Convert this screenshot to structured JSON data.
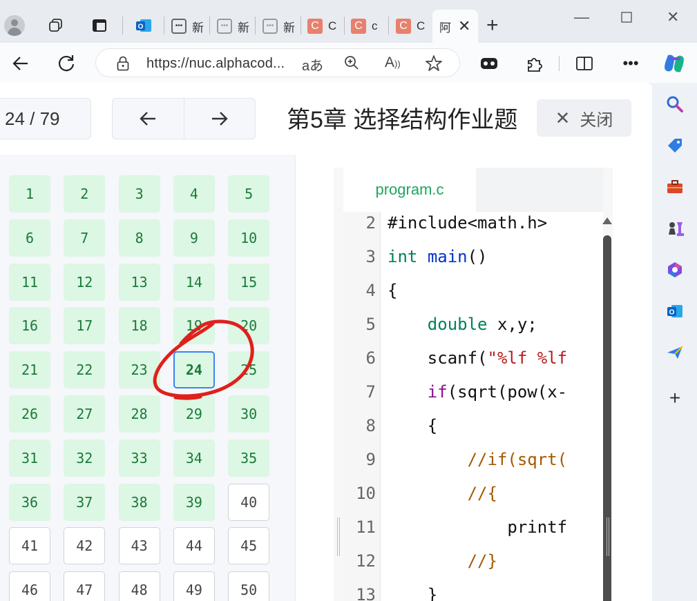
{
  "browser": {
    "tabs": [
      {
        "label": "",
        "kind": "workspaces"
      },
      {
        "label": "",
        "kind": "vertical-tabs"
      },
      {
        "label": "",
        "kind": "outlook"
      },
      {
        "label": "新",
        "kind": "page"
      },
      {
        "label": "新",
        "kind": "page"
      },
      {
        "label": "新",
        "kind": "page"
      },
      {
        "label": "C",
        "kind": "c"
      },
      {
        "label": "c",
        "kind": "c"
      },
      {
        "label": "C",
        "kind": "c"
      },
      {
        "label": "阿",
        "kind": "active"
      }
    ],
    "url": "https://nuc.alphacod...",
    "read_aloud_text": "A"
  },
  "header": {
    "counter": "24 / 79",
    "title": "第5章 选择结构作业题",
    "close_label": "关闭"
  },
  "questions": {
    "current": 24,
    "done_upto": 39,
    "items": [
      "1",
      "2",
      "3",
      "4",
      "5",
      "6",
      "7",
      "8",
      "9",
      "10",
      "11",
      "12",
      "13",
      "14",
      "15",
      "16",
      "17",
      "18",
      "19",
      "20",
      "21",
      "22",
      "23",
      "24",
      "25",
      "26",
      "27",
      "28",
      "29",
      "30",
      "31",
      "32",
      "33",
      "34",
      "35",
      "36",
      "37",
      "38",
      "39",
      "40",
      "41",
      "42",
      "43",
      "44",
      "45",
      "46",
      "47",
      "48",
      "49",
      "50"
    ]
  },
  "editor": {
    "filename": "program.c",
    "line_numbers": [
      "2",
      "3",
      "4",
      "5",
      "6",
      "7",
      "8",
      "9",
      "10",
      "11",
      "12",
      "13"
    ],
    "lines": [
      [
        {
          "t": "#include<math.h>",
          "c": ""
        }
      ],
      [
        {
          "t": "int",
          "c": "kw-type"
        },
        {
          "t": " ",
          "c": ""
        },
        {
          "t": "main",
          "c": "kw-fn"
        },
        {
          "t": "()",
          "c": ""
        }
      ],
      [
        {
          "t": "{",
          "c": ""
        }
      ],
      [
        {
          "t": "    ",
          "c": ""
        },
        {
          "t": "double",
          "c": "kw-type"
        },
        {
          "t": " x,y;",
          "c": ""
        }
      ],
      [
        {
          "t": "    scanf(",
          "c": ""
        },
        {
          "t": "\"%lf %lf",
          "c": "str"
        }
      ],
      [
        {
          "t": "    ",
          "c": ""
        },
        {
          "t": "if",
          "c": "kw-ctl"
        },
        {
          "t": "(sqrt(pow(x-",
          "c": ""
        }
      ],
      [
        {
          "t": "    {",
          "c": ""
        }
      ],
      [
        {
          "t": "        //if(sqrt(",
          "c": "cmt"
        }
      ],
      [
        {
          "t": "        //{",
          "c": "cmt"
        }
      ],
      [
        {
          "t": "            printf",
          "c": ""
        }
      ],
      [
        {
          "t": "        //}",
          "c": "cmt"
        }
      ],
      [
        {
          "t": "    }",
          "c": ""
        }
      ]
    ]
  },
  "colors": {
    "done_bg": "#dcf7e3",
    "done_text": "#1b7a3a",
    "current_border": "#3b82f6",
    "annotation": "#e0201c"
  }
}
